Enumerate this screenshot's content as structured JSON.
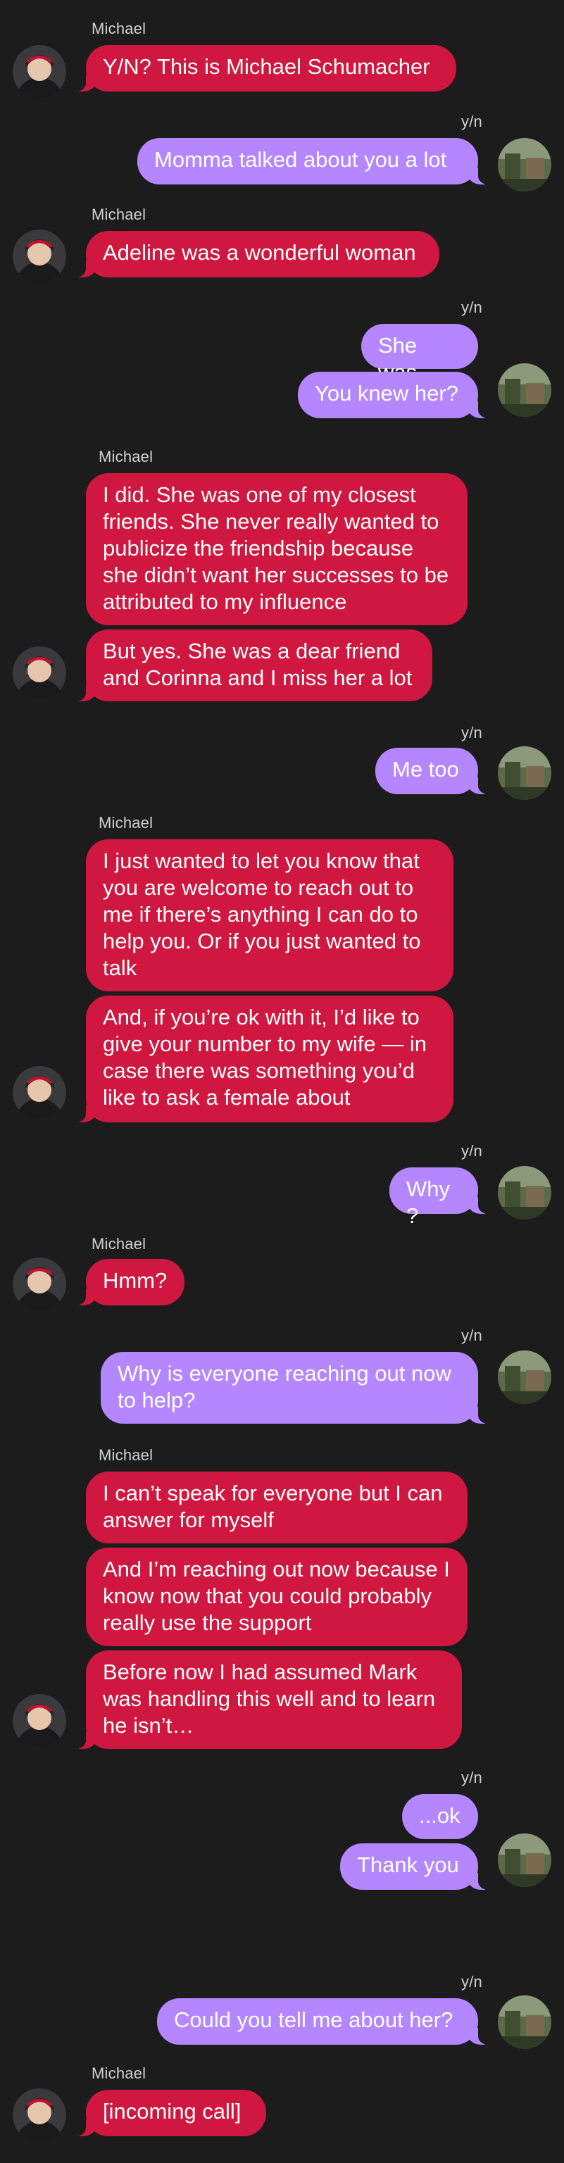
{
  "contacts": {
    "incoming_name": "Michael",
    "outgoing_name": "y/n",
    "incoming_bubble_color": "#d0173f",
    "outgoing_bubble_color": "#b486ff",
    "background_color": "#1c1c1c"
  },
  "messages": [
    {
      "from": "Michael",
      "text": "Y/N? This is Michael Schumacher"
    },
    {
      "from": "y/n",
      "text": "Momma talked about you a lot"
    },
    {
      "from": "Michael",
      "text": "Adeline was a wonderful woman"
    },
    {
      "from": "y/n",
      "text": "She was"
    },
    {
      "from": "y/n",
      "text": "You knew her?"
    },
    {
      "from": "Michael",
      "text": "I did. She was one of my closest friends. She never really wanted to publicize the friendship because she didn’t want her successes to be attributed to my influence"
    },
    {
      "from": "Michael",
      "text": "But yes. She was a dear friend and Corinna and I miss her a lot"
    },
    {
      "from": "y/n",
      "text": "Me too"
    },
    {
      "from": "Michael",
      "text": "I just wanted to let you know that you are welcome to reach out to me if there’s anything I can do to help you. Or if you just wanted to talk"
    },
    {
      "from": "Michael",
      "text": "And, if you’re ok with it, I’d like to give your number to my wife — in case there was something you’d like to ask a female about"
    },
    {
      "from": "y/n",
      "text": "Why?"
    },
    {
      "from": "Michael",
      "text": "Hmm?"
    },
    {
      "from": "y/n",
      "text": "Why is everyone reaching out now to help?"
    },
    {
      "from": "Michael",
      "text": "I can’t speak for everyone but I can answer for myself"
    },
    {
      "from": "Michael",
      "text": "And I’m reaching out now because I know now that you could probably really use the support"
    },
    {
      "from": "Michael",
      "text": "Before now I had assumed Mark was handling this well and to learn he isn’t…"
    },
    {
      "from": "y/n",
      "text": "...ok"
    },
    {
      "from": "y/n",
      "text": "Thank you"
    },
    {
      "from": "y/n",
      "text": "Could you tell me about her?"
    },
    {
      "from": "Michael",
      "text": "[incoming call]"
    }
  ]
}
